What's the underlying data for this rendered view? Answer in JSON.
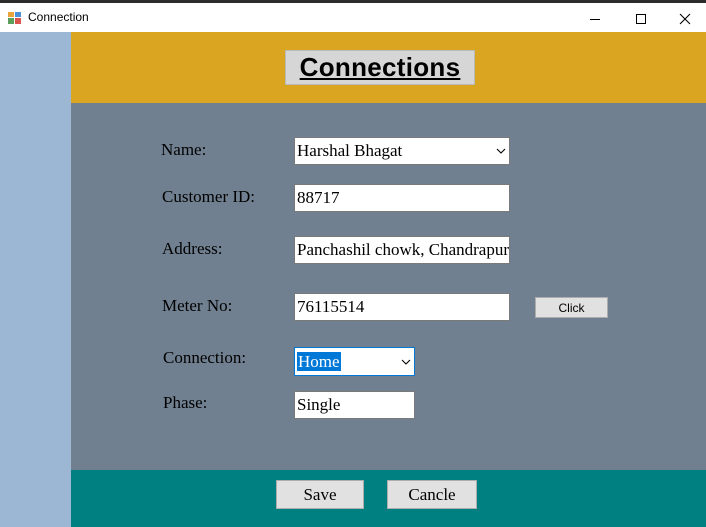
{
  "window": {
    "title": "Connection",
    "minimize_icon": "minimize-icon",
    "maximize_icon": "maximize-icon",
    "close_icon": "close-icon"
  },
  "header": {
    "title": "Connections",
    "color": "#daa520"
  },
  "colors": {
    "left_panel": "#9bb7d4",
    "form_background": "#708090",
    "footer_background": "#008080",
    "selection": "#0078d7"
  },
  "form": {
    "name_label": "Name:",
    "name_value": "Harshal Bhagat",
    "customer_id_label": "Customer ID:",
    "customer_id_value": "88717",
    "address_label": "Address:",
    "address_value": "Panchashil chowk, Chandrapur",
    "meter_no_label": "Meter No:",
    "meter_no_value": "76115514",
    "click_button_label": "Click",
    "connection_label": "Connection:",
    "connection_value": "Home",
    "phase_label": "Phase:",
    "phase_value": "Single"
  },
  "footer": {
    "save_label": "Save",
    "cancel_label": "Cancle"
  }
}
